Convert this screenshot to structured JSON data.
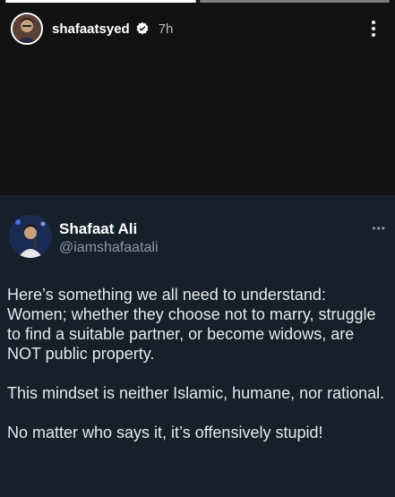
{
  "story": {
    "username": "shafaatsyed",
    "time": "7h",
    "progress_segments": 2,
    "active_segment": 1
  },
  "tweet": {
    "display_name": "Shafaat Ali",
    "handle": "@iamshafaatali",
    "paragraphs": [
      "Here’s something we all need to understand: Women; whether they choose not to marry, struggle to find a suitable partner, or become widows, are NOT public property.",
      "This mindset is neither Islamic, humane, nor rational.",
      "No matter who says it, it’s offensively stupid!"
    ]
  },
  "colors": {
    "story_background": "#121212",
    "tweet_background": "#15202b",
    "handle_gray": "#8b98a5"
  },
  "icons": {
    "verified": "verified-badge-icon",
    "more": "more-vertical-icon",
    "tweet_more": "more-horizontal-icon"
  }
}
